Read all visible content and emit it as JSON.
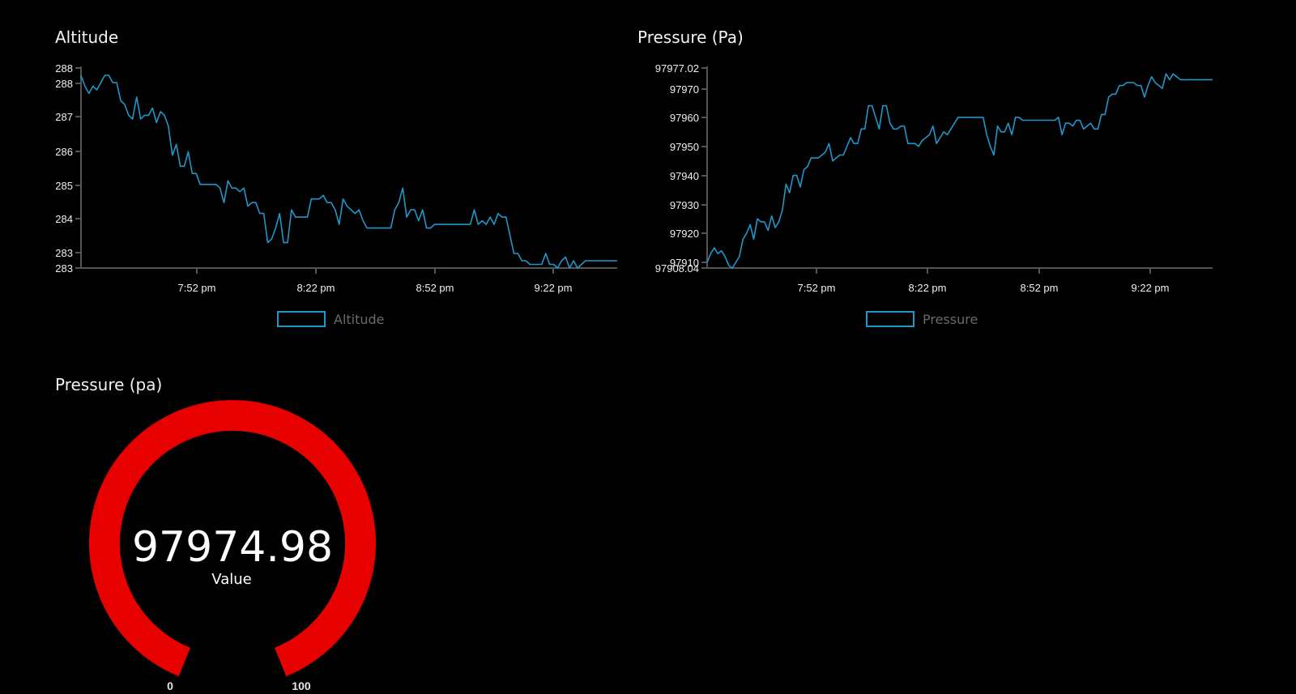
{
  "colors": {
    "background": "#000000",
    "line": "#1f97c9",
    "axis": "#555555",
    "gauge": "#e60000",
    "legend_text": "#6a6a6a"
  },
  "chart_data": [
    {
      "type": "line",
      "title": "Altitude",
      "x_tick_labels": [
        "7:52 pm",
        "8:22 pm",
        "8:52 pm",
        "9:22 pm"
      ],
      "y_tick_labels": [
        "288",
        "288",
        "287",
        "286",
        "285",
        "284",
        "283",
        "283"
      ],
      "ylim": [
        282.9,
        288.4
      ],
      "legend": {
        "position": "bottom",
        "entries": [
          "Altitude"
        ]
      },
      "grid": false,
      "series": [
        {
          "name": "Altitude",
          "values": [
            288.2,
            287.9,
            287.7,
            287.9,
            287.8,
            288.0,
            288.2,
            288.2,
            288.0,
            288.0,
            287.5,
            287.4,
            287.1,
            287.0,
            287.6,
            287.0,
            287.1,
            287.1,
            287.3,
            286.9,
            287.2,
            287.1,
            286.8,
            286.0,
            286.3,
            285.7,
            285.7,
            286.1,
            285.5,
            285.5,
            285.2,
            285.2,
            285.2,
            285.2,
            285.2,
            285.1,
            284.7,
            285.3,
            285.1,
            285.1,
            285.0,
            285.1,
            284.6,
            284.7,
            284.7,
            284.4,
            284.4,
            283.6,
            283.7,
            284.0,
            284.4,
            283.6,
            283.6,
            284.5,
            284.3,
            284.3,
            284.3,
            284.3,
            284.8,
            284.8,
            284.8,
            284.9,
            284.7,
            284.7,
            284.5,
            284.1,
            284.8,
            284.6,
            284.5,
            284.4,
            284.5,
            284.2,
            284.0,
            284.0,
            284.0,
            284.0,
            284.0,
            284.0,
            284.0,
            284.5,
            284.7,
            285.1,
            284.3,
            284.5,
            284.5,
            284.2,
            284.5,
            284.0,
            284.0,
            284.1,
            284.1,
            284.1,
            284.1,
            284.1,
            284.1,
            284.1,
            284.1,
            284.1,
            284.1,
            284.5,
            284.1,
            284.2,
            284.1,
            284.3,
            284.1,
            284.4,
            284.3,
            284.3,
            283.8,
            283.3,
            283.3,
            283.1,
            283.1,
            283.0,
            283.0,
            283.0,
            283.0,
            283.3,
            283.0,
            283.0,
            282.9,
            283.1,
            283.2,
            282.9,
            283.1,
            282.9,
            283.0,
            283.1,
            283.1,
            283.1,
            283.1,
            283.1,
            283.1,
            283.1,
            283.1,
            283.1
          ]
        }
      ]
    },
    {
      "type": "line",
      "title": "Pressure (Pa)",
      "x_tick_labels": [
        "7:52 pm",
        "8:22 pm",
        "8:52 pm",
        "9:22 pm"
      ],
      "y_tick_labels": [
        "97977.02",
        "97970",
        "97960",
        "97950",
        "97940",
        "97930",
        "97920",
        "97910",
        "97908.04"
      ],
      "ylim": [
        97908.04,
        97977.02
      ],
      "legend": {
        "position": "bottom",
        "entries": [
          "Pressure"
        ]
      },
      "grid": false,
      "series": [
        {
          "name": "Pressure",
          "values": [
            97910,
            97913,
            97915,
            97913,
            97914,
            97912,
            97909,
            97908,
            97910,
            97912,
            97918,
            97920,
            97923,
            97918,
            97925,
            97924,
            97924,
            97921,
            97926,
            97922,
            97924,
            97928,
            97937,
            97934,
            97940,
            97940,
            97936,
            97942,
            97943,
            97946,
            97946,
            97946,
            97947,
            97948,
            97951,
            97945,
            97946,
            97947,
            97947,
            97950,
            97953,
            97951,
            97951,
            97956,
            97956,
            97964,
            97964,
            97960,
            97956,
            97964,
            97964,
            97958,
            97956,
            97956,
            97957,
            97957,
            97951,
            97951,
            97951,
            97950,
            97952,
            97953,
            97954,
            97957,
            97951,
            97953,
            97955,
            97954,
            97956,
            97958,
            97960,
            97960,
            97960,
            97960,
            97960,
            97960,
            97960,
            97960,
            97954,
            97950,
            97947,
            97957,
            97955,
            97955,
            97958,
            97954,
            97960,
            97960,
            97959,
            97959,
            97959,
            97959,
            97959,
            97959,
            97959,
            97959,
            97959,
            97959,
            97960,
            97954,
            97958,
            97958,
            97957,
            97959,
            97959,
            97956,
            97957,
            97958,
            97956,
            97956,
            97961,
            97961,
            97967,
            97968,
            97968,
            97971,
            97971,
            97972,
            97972,
            97972,
            97971,
            97971,
            97967,
            97971,
            97974,
            97972,
            97971,
            97970,
            97975,
            97973,
            97975,
            97974,
            97973,
            97973,
            97973,
            97973,
            97973,
            97973,
            97973,
            97973,
            97973,
            97973
          ]
        }
      ]
    }
  ],
  "gauge": {
    "title": "Pressure (pa)",
    "value": "97974.98",
    "caption": "Value",
    "min_label": "0",
    "max_label": "100",
    "min": 0,
    "max": 100,
    "color": "#e60000"
  }
}
